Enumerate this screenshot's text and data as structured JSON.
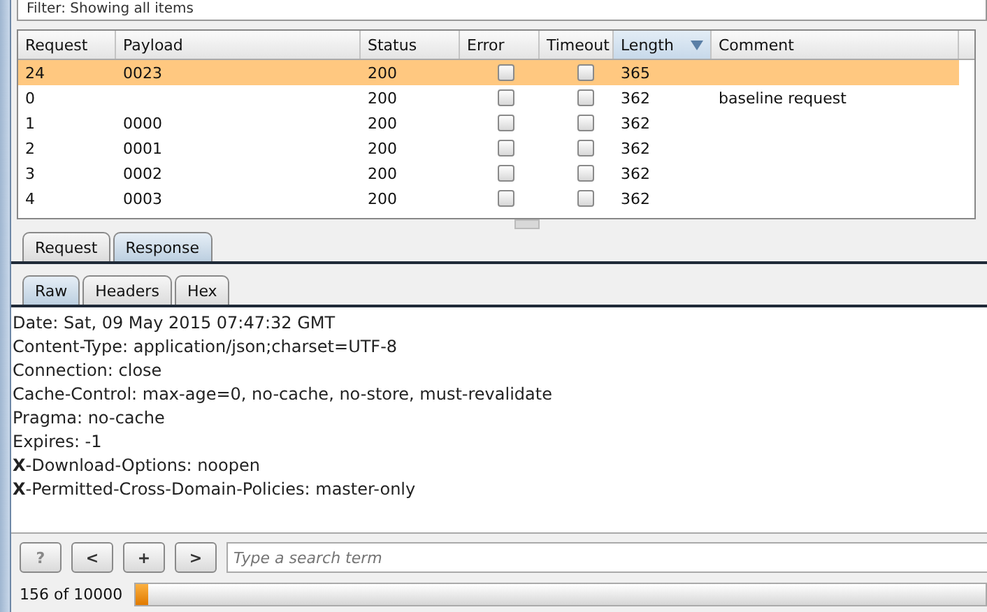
{
  "filter": {
    "text": "Filter: Showing all items"
  },
  "table": {
    "columns": [
      {
        "label": "Request",
        "sorted": false
      },
      {
        "label": "Payload",
        "sorted": false
      },
      {
        "label": "Status",
        "sorted": false
      },
      {
        "label": "Error",
        "sorted": false
      },
      {
        "label": "Timeout",
        "sorted": false
      },
      {
        "label": "Length",
        "sorted": true
      },
      {
        "label": "Comment",
        "sorted": false
      }
    ],
    "rows": [
      {
        "request": "24",
        "payload": "0023",
        "status": "200",
        "error": false,
        "timeout": false,
        "length": "365",
        "comment": "",
        "selected": true
      },
      {
        "request": "0",
        "payload": "",
        "status": "200",
        "error": false,
        "timeout": false,
        "length": "362",
        "comment": "baseline request",
        "selected": false
      },
      {
        "request": "1",
        "payload": "0000",
        "status": "200",
        "error": false,
        "timeout": false,
        "length": "362",
        "comment": "",
        "selected": false
      },
      {
        "request": "2",
        "payload": "0001",
        "status": "200",
        "error": false,
        "timeout": false,
        "length": "362",
        "comment": "",
        "selected": false
      },
      {
        "request": "3",
        "payload": "0002",
        "status": "200",
        "error": false,
        "timeout": false,
        "length": "362",
        "comment": "",
        "selected": false
      },
      {
        "request": "4",
        "payload": "0003",
        "status": "200",
        "error": false,
        "timeout": false,
        "length": "362",
        "comment": "",
        "selected": false
      }
    ]
  },
  "tabs": [
    {
      "label": "Request",
      "selected": false
    },
    {
      "label": "Response",
      "selected": true
    }
  ],
  "view_tabs": [
    {
      "label": "Raw",
      "selected": true
    },
    {
      "label": "Headers",
      "selected": false
    },
    {
      "label": "Hex",
      "selected": false
    }
  ],
  "response_lines": [
    "Date: Sat, 09 May 2015 07:47:32 GMT",
    "Content-Type: application/json;charset=UTF-8",
    "Connection: close",
    "Cache-Control: max-age=0, no-cache, no-store, must-revalidate",
    "Pragma: no-cache",
    "Expires: -1",
    "**X**-Download-Options: noopen",
    "**X**-Permitted-Cross-Domain-Policies: master-only"
  ],
  "search_bar": {
    "buttons": [
      "?",
      "<",
      "+",
      ">"
    ],
    "placeholder": "Type a search term"
  },
  "progress": {
    "text": "156 of 10000",
    "level": 0.0156
  }
}
